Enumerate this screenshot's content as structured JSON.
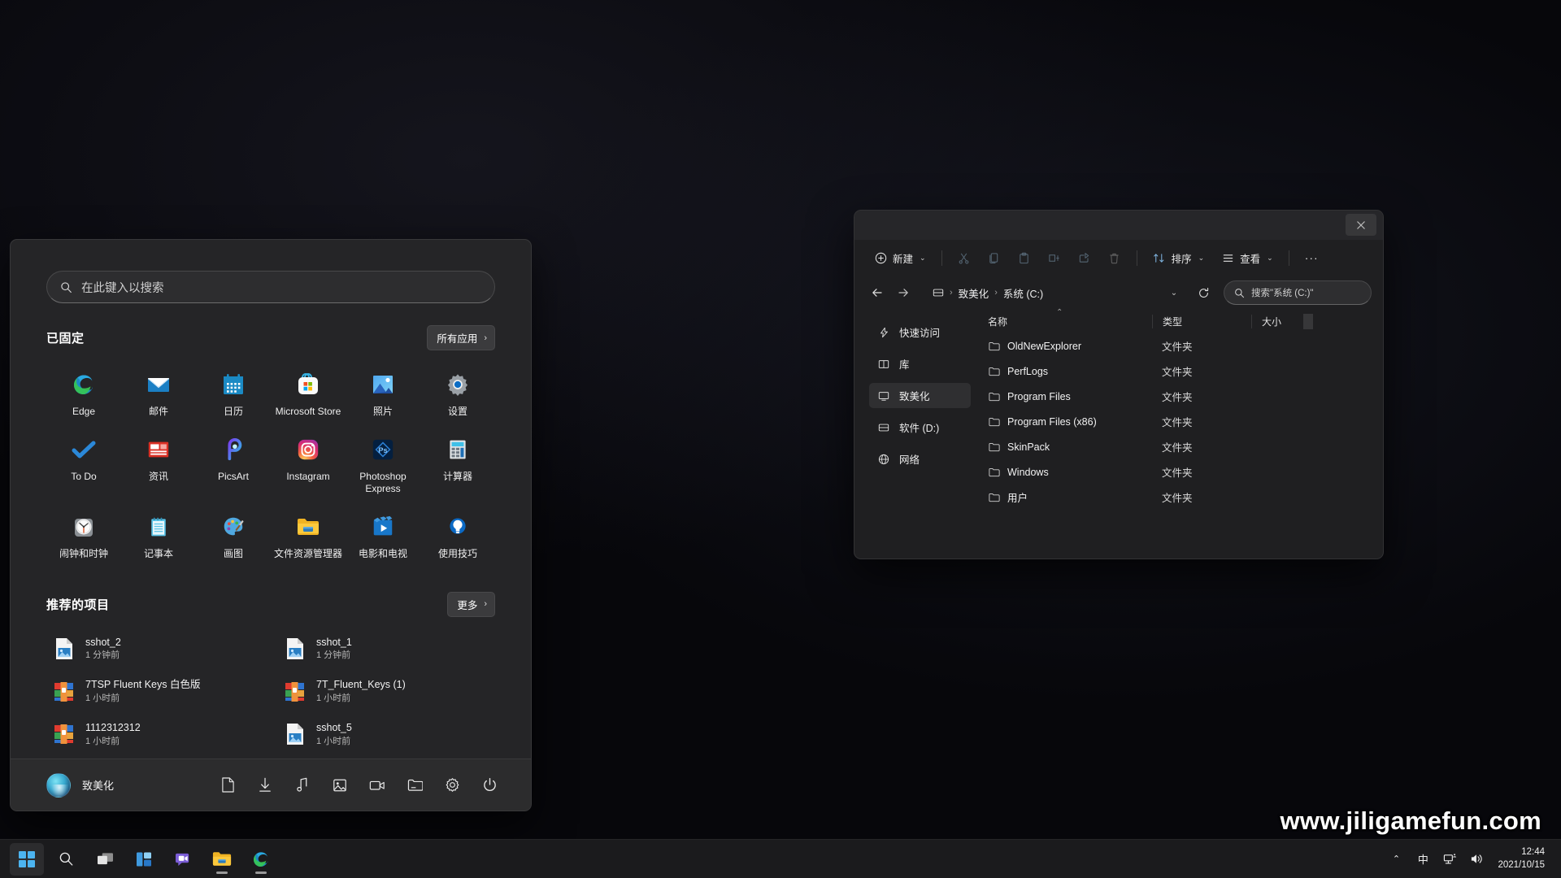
{
  "desktop": {
    "watermark": "www.jiligamefun.com"
  },
  "start_menu": {
    "search": {
      "placeholder": "在此键入以搜索",
      "icon": "search-icon"
    },
    "pinned": {
      "title": "已固定",
      "all_apps_label": "所有应用",
      "chevron": "›",
      "apps": [
        {
          "label": "Edge",
          "icon": "edge-icon"
        },
        {
          "label": "邮件",
          "icon": "mail-icon"
        },
        {
          "label": "日历",
          "icon": "calendar-icon"
        },
        {
          "label": "Microsoft Store",
          "icon": "store-icon"
        },
        {
          "label": "照片",
          "icon": "photos-icon"
        },
        {
          "label": "设置",
          "icon": "settings-gear-icon"
        },
        {
          "label": "To Do",
          "icon": "todo-check-icon"
        },
        {
          "label": "资讯",
          "icon": "news-icon"
        },
        {
          "label": "PicsArt",
          "icon": "picsart-icon"
        },
        {
          "label": "Instagram",
          "icon": "instagram-icon"
        },
        {
          "label": "Photoshop Express",
          "icon": "photoshop-express-icon"
        },
        {
          "label": "计算器",
          "icon": "calculator-icon"
        },
        {
          "label": "闹钟和时钟",
          "icon": "alarm-clock-icon"
        },
        {
          "label": "记事本",
          "icon": "notepad-icon"
        },
        {
          "label": "画图",
          "icon": "paint-palette-icon"
        },
        {
          "label": "文件资源管理器",
          "icon": "file-explorer-icon"
        },
        {
          "label": "电影和电视",
          "icon": "movies-tv-icon"
        },
        {
          "label": "使用技巧",
          "icon": "tips-bulb-icon"
        }
      ]
    },
    "recommended": {
      "title": "推荐的项目",
      "more_label": "更多",
      "chevron": "›",
      "items": [
        {
          "name": "sshot_2",
          "time": "1 分钟前",
          "icon": "image-file-icon"
        },
        {
          "name": "sshot_1",
          "time": "1 分钟前",
          "icon": "image-file-icon"
        },
        {
          "name": "7TSP Fluent Keys 白色版",
          "time": "1 小时前",
          "icon": "archive-file-icon"
        },
        {
          "name": "7T_Fluent_Keys (1)",
          "time": "1 小时前",
          "icon": "archive-file-icon"
        },
        {
          "name": "1112312312",
          "time": "1 小时前",
          "icon": "archive-file-icon"
        },
        {
          "name": "sshot_5",
          "time": "1 小时前",
          "icon": "image-file-icon"
        }
      ]
    },
    "footer": {
      "user_name": "致美化",
      "icons": [
        "document-icon",
        "downloads-icon",
        "music-icon",
        "pictures-icon",
        "videos-icon",
        "file-explorer-icon",
        "settings-gear-icon",
        "power-icon"
      ]
    }
  },
  "explorer": {
    "close_label": "✕",
    "toolbar": {
      "new_label": "新建",
      "sort_label": "排序",
      "view_label": "查看",
      "more_label": "···",
      "chevron": "⌄",
      "icons": [
        "new-plus-icon",
        "cut-icon",
        "copy-icon",
        "paste-icon",
        "rename-icon",
        "share-icon",
        "delete-icon",
        "sort-icon",
        "view-icon",
        "more-icon"
      ]
    },
    "address": {
      "back_icon": "back-arrow-icon",
      "forward_icon": "forward-arrow-icon",
      "drive_icon": "drive-icon",
      "crumbs": [
        "致美化",
        "系统 (C:)"
      ],
      "separator": "›",
      "dropdown_chevron": "⌄",
      "refresh_icon": "refresh-icon",
      "search_placeholder": "搜索\"系统 (C:)\"",
      "search_icon": "search-icon"
    },
    "sidebar": [
      {
        "label": "快速访问",
        "icon": "pin-quick-access-icon",
        "selected": false
      },
      {
        "label": "库",
        "icon": "library-icon",
        "selected": false
      },
      {
        "label": "致美化",
        "icon": "this-pc-icon",
        "selected": true
      },
      {
        "label": "软件 (D:)",
        "icon": "drive-icon",
        "selected": false
      },
      {
        "label": "网络",
        "icon": "network-globe-icon",
        "selected": false
      }
    ],
    "columns": {
      "name": "名称",
      "type": "类型",
      "size": "大小",
      "sort_caret": "⌃"
    },
    "rows": [
      {
        "name": "OldNewExplorer",
        "type": "文件夹",
        "size": ""
      },
      {
        "name": "PerfLogs",
        "type": "文件夹",
        "size": ""
      },
      {
        "name": "Program Files",
        "type": "文件夹",
        "size": ""
      },
      {
        "name": "Program Files (x86)",
        "type": "文件夹",
        "size": ""
      },
      {
        "name": "SkinPack",
        "type": "文件夹",
        "size": ""
      },
      {
        "name": "Windows",
        "type": "文件夹",
        "size": ""
      },
      {
        "name": "用户",
        "type": "文件夹",
        "size": ""
      }
    ]
  },
  "taskbar": {
    "items": [
      {
        "name": "start",
        "icon": "windows-start-icon",
        "active": true,
        "running": false
      },
      {
        "name": "search",
        "icon": "search-icon",
        "active": false,
        "running": false
      },
      {
        "name": "task-view",
        "icon": "task-view-icon",
        "active": false,
        "running": false
      },
      {
        "name": "widgets",
        "icon": "widgets-icon",
        "active": false,
        "running": false
      },
      {
        "name": "chat",
        "icon": "chat-teams-icon",
        "active": false,
        "running": false
      },
      {
        "name": "file-explorer",
        "icon": "file-explorer-icon",
        "active": false,
        "running": true
      },
      {
        "name": "edge",
        "icon": "edge-icon",
        "active": false,
        "running": true
      }
    ],
    "tray": {
      "chevron": "⌃",
      "ime": "中",
      "network_icon": "network-icon",
      "volume_icon": "volume-icon",
      "time": "12:44",
      "date": "2021/10/15"
    }
  }
}
